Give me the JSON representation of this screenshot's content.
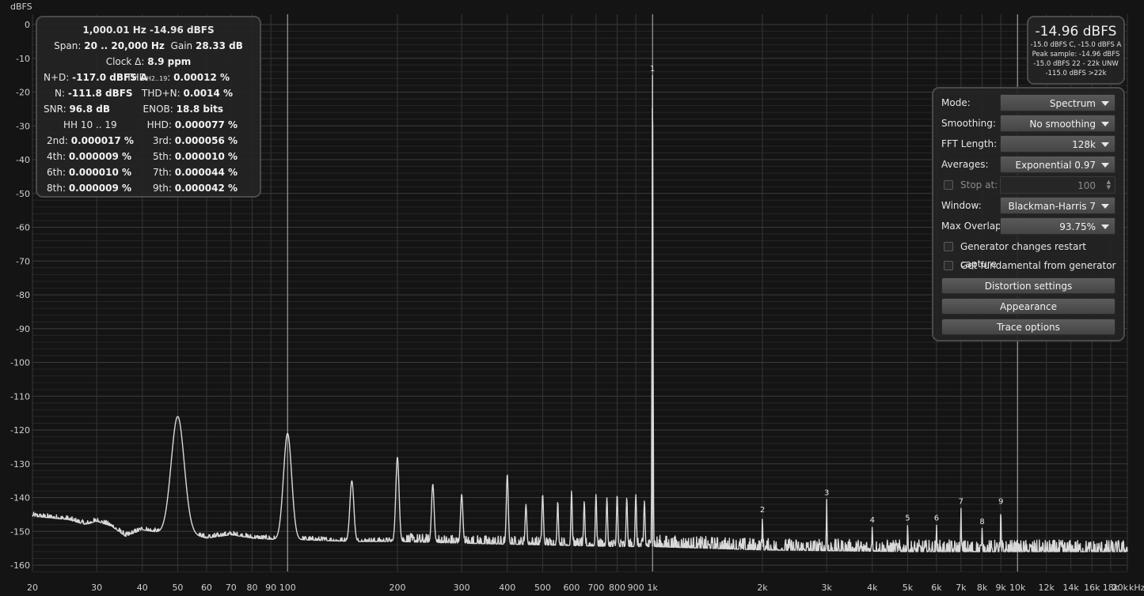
{
  "axis": {
    "y_unit": "dBFS",
    "x_unit": "kHz"
  },
  "stats": {
    "line1": "1,000.01 Hz  -14.96 dBFS",
    "span_label": "Span:",
    "span_value": "20 .. 20,000 Hz",
    "gain_label": "Gain",
    "gain_value": "28.33 dB",
    "clock_label": "Clock Δ:",
    "clock_value": "8.9 ppm",
    "nd_label": "N+D:",
    "nd_value": "-117.0 dBFS A",
    "thd_label": "THD",
    "thd_sub": "H2..19",
    "thd_value": "0.00012 %",
    "n_label": "N:",
    "n_value": "-111.8 dBFS",
    "thdn_label": "THD+N:",
    "thdn_value": "0.0014 %",
    "snr_label": "SNR:",
    "snr_value": "96.8 dB",
    "enob_label": "ENOB:",
    "enob_value": "18.8 bits",
    "hh_label": "HH 10 .. 19",
    "hhd_label": "HHD:",
    "hhd_value": "0.000077 %",
    "h2_label": "2nd:",
    "h2_value": "0.000017 %",
    "h3_label": "3rd:",
    "h3_value": "0.000056 %",
    "h4_label": "4th:",
    "h4_value": "0.000009 %",
    "h5_label": "5th:",
    "h5_value": "0.000010 %",
    "h6_label": "6th:",
    "h6_value": "0.000010 %",
    "h7_label": "7th:",
    "h7_value": "0.000044 %",
    "h8_label": "8th:",
    "h8_value": "0.000009 %",
    "h9_label": "9th:",
    "h9_value": "0.000042 %"
  },
  "level": {
    "main": "-14.96 dBFS",
    "line1": "-15.0 dBFS C, -15.0 dBFS A",
    "line2": "Peak sample: -14.96 dBFS",
    "line3": "-15.0 dBFS 22 - 22k UNW",
    "line4": "-115.0 dBFS >22k"
  },
  "settings": {
    "mode_label": "Mode:",
    "mode_value": "Spectrum",
    "smoothing_label": "Smoothing:",
    "smoothing_value": "No smoothing",
    "fft_label": "FFT Length:",
    "fft_value": "128k",
    "averages_label": "Averages:",
    "averages_value": "Exponential 0.97",
    "stop_label": "Stop at:",
    "stop_value": "100",
    "window_label": "Window:",
    "window_value": "Blackman-Harris 7",
    "overlap_label": "Max Overlap:",
    "overlap_value": "93.75%",
    "gen_restart_label": "Generator changes restart capture",
    "fundamental_label": "Get fundamental from generator",
    "distortion_button": "Distortion settings",
    "appearance_button": "Appearance",
    "trace_button": "Trace options"
  },
  "chart_data": {
    "type": "line",
    "x_scale": "log",
    "xlim": [
      20,
      20000
    ],
    "ylim": [
      -163,
      2
    ],
    "grid": true,
    "yticks": [
      0,
      -10,
      -20,
      -30,
      -40,
      -50,
      -60,
      -70,
      -80,
      -90,
      -100,
      -110,
      -120,
      -130,
      -140,
      -150,
      -160
    ],
    "xticks": [
      {
        "v": 20,
        "label": "20"
      },
      {
        "v": 30,
        "label": "30"
      },
      {
        "v": 40,
        "label": "40"
      },
      {
        "v": 50,
        "label": "50"
      },
      {
        "v": 60,
        "label": "60"
      },
      {
        "v": 70,
        "label": "70"
      },
      {
        "v": 80,
        "label": "80"
      },
      {
        "v": 90,
        "label": "90"
      },
      {
        "v": 100,
        "label": "100"
      },
      {
        "v": 200,
        "label": "200"
      },
      {
        "v": 300,
        "label": "300"
      },
      {
        "v": 400,
        "label": "400"
      },
      {
        "v": 500,
        "label": "500"
      },
      {
        "v": 600,
        "label": "600"
      },
      {
        "v": 700,
        "label": "700"
      },
      {
        "v": 800,
        "label": "800"
      },
      {
        "v": 900,
        "label": "900"
      },
      {
        "v": 1000,
        "label": "1k"
      },
      {
        "v": 2000,
        "label": "2k"
      },
      {
        "v": 3000,
        "label": "3k"
      },
      {
        "v": 4000,
        "label": "4k"
      },
      {
        "v": 5000,
        "label": "5k"
      },
      {
        "v": 6000,
        "label": "6k"
      },
      {
        "v": 7000,
        "label": "7k"
      },
      {
        "v": 8000,
        "label": "8k"
      },
      {
        "v": 9000,
        "label": "9k"
      },
      {
        "v": 10000,
        "label": "10k"
      },
      {
        "v": 12000,
        "label": "12k"
      },
      {
        "v": 14000,
        "label": "14k"
      },
      {
        "v": 16000,
        "label": "16k"
      },
      {
        "v": 18000,
        "label": "18k"
      },
      {
        "v": 20000,
        "label": "20k"
      }
    ],
    "major_x": [
      100,
      1000,
      10000
    ],
    "noise_floor_low": [
      [
        20,
        -145.5
      ],
      [
        25,
        -146.5
      ],
      [
        28,
        -148
      ],
      [
        30,
        -147
      ],
      [
        33,
        -148.5
      ],
      [
        36,
        -151.5
      ],
      [
        40,
        -149.5
      ],
      [
        45,
        -150.5
      ],
      [
        55,
        -151
      ],
      [
        60,
        -152
      ],
      [
        70,
        -151
      ],
      [
        80,
        -152
      ],
      [
        95,
        -152.5
      ],
      [
        110,
        -152.5
      ],
      [
        150,
        -153
      ],
      [
        200,
        -153
      ],
      [
        300,
        -153.5
      ],
      [
        500,
        -154
      ],
      [
        800,
        -154.5
      ],
      [
        1000,
        -154.5
      ],
      [
        2000,
        -155.5
      ],
      [
        5000,
        -156
      ],
      [
        10000,
        -156
      ],
      [
        20000,
        -156
      ]
    ],
    "peaks": [
      {
        "f": 50,
        "db": -116,
        "w": 0.04
      },
      {
        "f": 100,
        "db": -121,
        "w": 0.025
      },
      {
        "f": 150,
        "db": -135,
        "w": 0.012
      },
      {
        "f": 200,
        "db": -128,
        "w": 0.01
      },
      {
        "f": 250,
        "db": -136,
        "w": 0.008
      },
      {
        "f": 300,
        "db": -139,
        "w": 0.007
      },
      {
        "f": 400,
        "db": -133,
        "w": 0.006
      },
      {
        "f": 450,
        "db": -142,
        "w": 0.005
      },
      {
        "f": 500,
        "db": -139,
        "w": 0.005
      },
      {
        "f": 550,
        "db": -141,
        "w": 0.004
      },
      {
        "f": 600,
        "db": -138,
        "w": 0.004
      },
      {
        "f": 650,
        "db": -141,
        "w": 0.004
      },
      {
        "f": 700,
        "db": -139,
        "w": 0.004
      },
      {
        "f": 750,
        "db": -140,
        "w": 0.004
      },
      {
        "f": 800,
        "db": -139,
        "w": 0.004
      },
      {
        "f": 850,
        "db": -140,
        "w": 0.004
      },
      {
        "f": 900,
        "db": -139,
        "w": 0.004
      },
      {
        "f": 950,
        "db": -141,
        "w": 0.004
      },
      {
        "f": 1000,
        "db": -14.96,
        "w": 0.003
      },
      {
        "f": 2000,
        "db": -145.5,
        "w": 0.002
      },
      {
        "f": 3000,
        "db": -140.5,
        "w": 0.002
      },
      {
        "f": 4000,
        "db": -148.5,
        "w": 0.002
      },
      {
        "f": 5000,
        "db": -148,
        "w": 0.002
      },
      {
        "f": 6000,
        "db": -148,
        "w": 0.002
      },
      {
        "f": 7000,
        "db": -143,
        "w": 0.002
      },
      {
        "f": 8000,
        "db": -149,
        "w": 0.002
      },
      {
        "f": 9000,
        "db": -143,
        "w": 0.002
      }
    ],
    "harmonic_markers": [
      {
        "n": "1",
        "f": 1000,
        "db": -14.96
      },
      {
        "n": "2",
        "f": 2000,
        "db": -145.5
      },
      {
        "n": "3",
        "f": 3000,
        "db": -140.5
      },
      {
        "n": "4",
        "f": 4000,
        "db": -148.5
      },
      {
        "n": "5",
        "f": 5000,
        "db": -148
      },
      {
        "n": "6",
        "f": 6000,
        "db": -148
      },
      {
        "n": "7",
        "f": 7000,
        "db": -143
      },
      {
        "n": "8",
        "f": 8000,
        "db": -149
      },
      {
        "n": "9",
        "f": 9000,
        "db": -143
      }
    ]
  }
}
